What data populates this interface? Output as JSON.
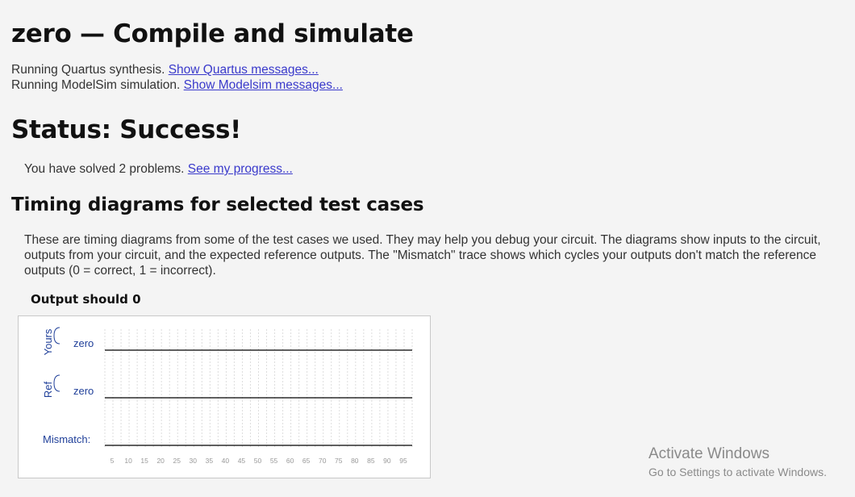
{
  "page": {
    "title": "zero — Compile and simulate"
  },
  "runs": [
    {
      "text": "Running Quartus synthesis. ",
      "link": "Show Quartus messages..."
    },
    {
      "text": "Running ModelSim simulation. ",
      "link": "Show Modelsim messages..."
    }
  ],
  "status": {
    "heading": "Status: Success!",
    "progress_text": "You have solved 2 problems. ",
    "progress_link": "See my progress..."
  },
  "timing": {
    "heading": "Timing diagrams for selected test cases",
    "description": "These are timing diagrams from some of the test cases we used. They may help you debug your circuit. The diagrams show inputs to the circuit, outputs from your circuit, and the expected reference outputs. The \"Mismatch\" trace shows which cycles your outputs don't match the reference outputs (0 = correct, 1 = incorrect).",
    "case_title": "Output should 0",
    "diagram": {
      "groups": [
        {
          "group_label": "Yours",
          "signal": "zero",
          "value": 0
        },
        {
          "group_label": "Ref",
          "signal": "zero",
          "value": 0
        }
      ],
      "mismatch_label": "Mismatch:",
      "mismatch_value": 0,
      "ticks": [
        "5",
        "10",
        "15",
        "20",
        "25",
        "30",
        "35",
        "40",
        "45",
        "50",
        "55",
        "60",
        "65",
        "70",
        "75",
        "80",
        "85",
        "90",
        "95"
      ],
      "colors": {
        "label": "#1f3f99",
        "tick": "#999999",
        "grid": "#dddddd",
        "trace": "#000000"
      }
    }
  },
  "watermark": {
    "line1": "Activate Windows",
    "line2": "Go to Settings to activate Windows."
  }
}
